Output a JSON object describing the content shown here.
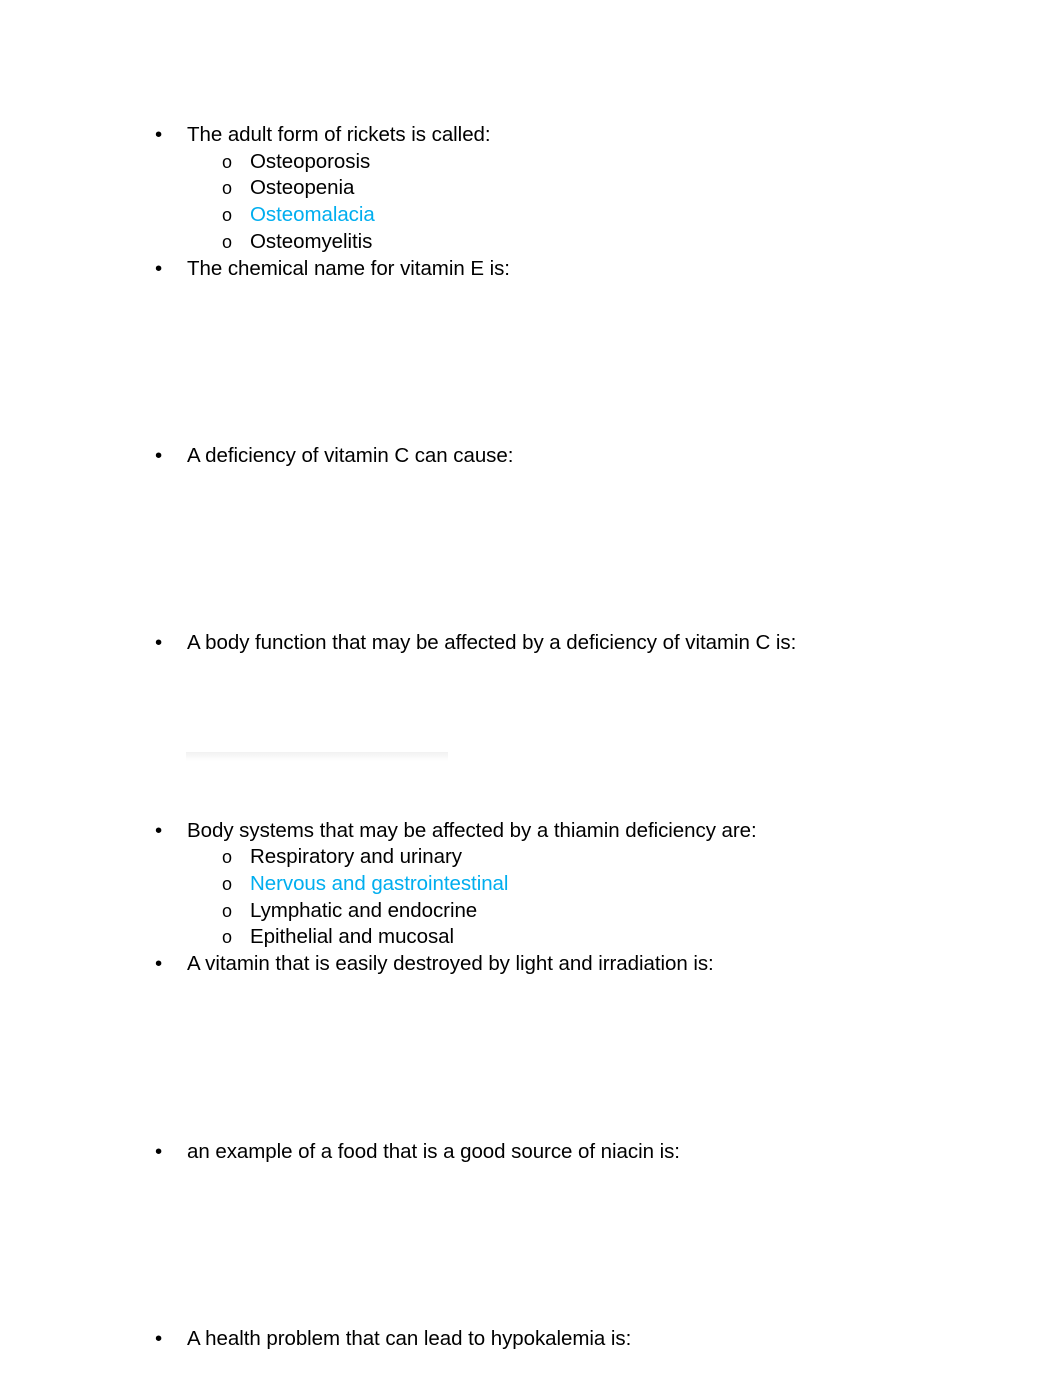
{
  "page": {
    "background_color": "#ffffff",
    "text_color": "#000000",
    "highlight_color": "#00aeef",
    "bullet_glyph": "•",
    "option_marker": "o"
  },
  "document": {
    "questions": [
      {
        "id": "q-rickets",
        "text": "The adult form of rickets is called:",
        "options": [
          {
            "label": "Osteoporosis",
            "selected": false,
            "blank": false
          },
          {
            "label": "Osteopenia",
            "selected": false,
            "blank": false
          },
          {
            "label": "Osteomalacia",
            "selected": true,
            "blank": false
          },
          {
            "label": "Osteomyelitis",
            "selected": false,
            "blank": false
          }
        ]
      },
      {
        "id": "q-vitamin-e-chemical-name",
        "text": "The chemical name for vitamin E is:",
        "options": [
          {
            "label": "",
            "selected": false,
            "blank": true
          },
          {
            "label": "",
            "selected": false,
            "blank": true
          },
          {
            "label": "",
            "selected": false,
            "blank": true
          },
          {
            "label": "",
            "selected": false,
            "blank": true
          },
          {
            "label": "",
            "selected": false,
            "blank": true
          },
          {
            "label": "",
            "selected": false,
            "blank": true
          }
        ]
      },
      {
        "id": "q-vitamin-c-deficiency-cause",
        "text": "A deficiency of vitamin C can cause:",
        "options": [
          {
            "label": "",
            "selected": false,
            "blank": true
          },
          {
            "label": "",
            "selected": false,
            "blank": true
          },
          {
            "label": "",
            "selected": false,
            "blank": true
          },
          {
            "label": "",
            "selected": false,
            "blank": true
          },
          {
            "label": "",
            "selected": false,
            "blank": true
          },
          {
            "label": "",
            "selected": false,
            "blank": true
          }
        ]
      },
      {
        "id": "q-vitamin-c-body-function",
        "text": "A body function that may be affected by a deficiency of vitamin C is:",
        "options": [
          {
            "label": "",
            "selected": false,
            "blank": true
          },
          {
            "label": "",
            "selected": false,
            "blank": true
          },
          {
            "label": "",
            "selected": false,
            "blank": true
          },
          {
            "label": "",
            "selected": false,
            "blank": true
          },
          {
            "label": "",
            "selected": false,
            "blank": true
          },
          {
            "label": "",
            "selected": false,
            "blank": true
          }
        ]
      },
      {
        "id": "q-thiamin-body-systems",
        "text": "Body systems that may be affected by a thiamin deficiency are:",
        "options": [
          {
            "label": "Respiratory and urinary",
            "selected": false,
            "blank": false
          },
          {
            "label": "Nervous and gastrointestinal",
            "selected": true,
            "blank": false
          },
          {
            "label": "Lymphatic and endocrine",
            "selected": false,
            "blank": false
          },
          {
            "label": "Epithelial and mucosal",
            "selected": false,
            "blank": false
          }
        ]
      },
      {
        "id": "q-vitamin-destroyed-by-light",
        "text": "A vitamin that is easily destroyed by light and irradiation is:",
        "options": [
          {
            "label": "",
            "selected": false,
            "blank": true
          },
          {
            "label": "",
            "selected": false,
            "blank": true
          },
          {
            "label": "",
            "selected": false,
            "blank": true
          },
          {
            "label": "",
            "selected": false,
            "blank": true
          },
          {
            "label": "",
            "selected": false,
            "blank": true
          },
          {
            "label": "",
            "selected": false,
            "blank": true
          }
        ]
      },
      {
        "id": "q-niacin-food-source",
        "text": "an example of a food that is a good source of niacin is:",
        "options": [
          {
            "label": "",
            "selected": false,
            "blank": true
          },
          {
            "label": "",
            "selected": false,
            "blank": true
          },
          {
            "label": "",
            "selected": false,
            "blank": true
          },
          {
            "label": "",
            "selected": false,
            "blank": true
          },
          {
            "label": "",
            "selected": false,
            "blank": true
          },
          {
            "label": "",
            "selected": false,
            "blank": true
          }
        ]
      },
      {
        "id": "q-hypokalemia-health-problem",
        "text": "A health problem that can lead to hypokalemia is:",
        "options": []
      }
    ]
  }
}
